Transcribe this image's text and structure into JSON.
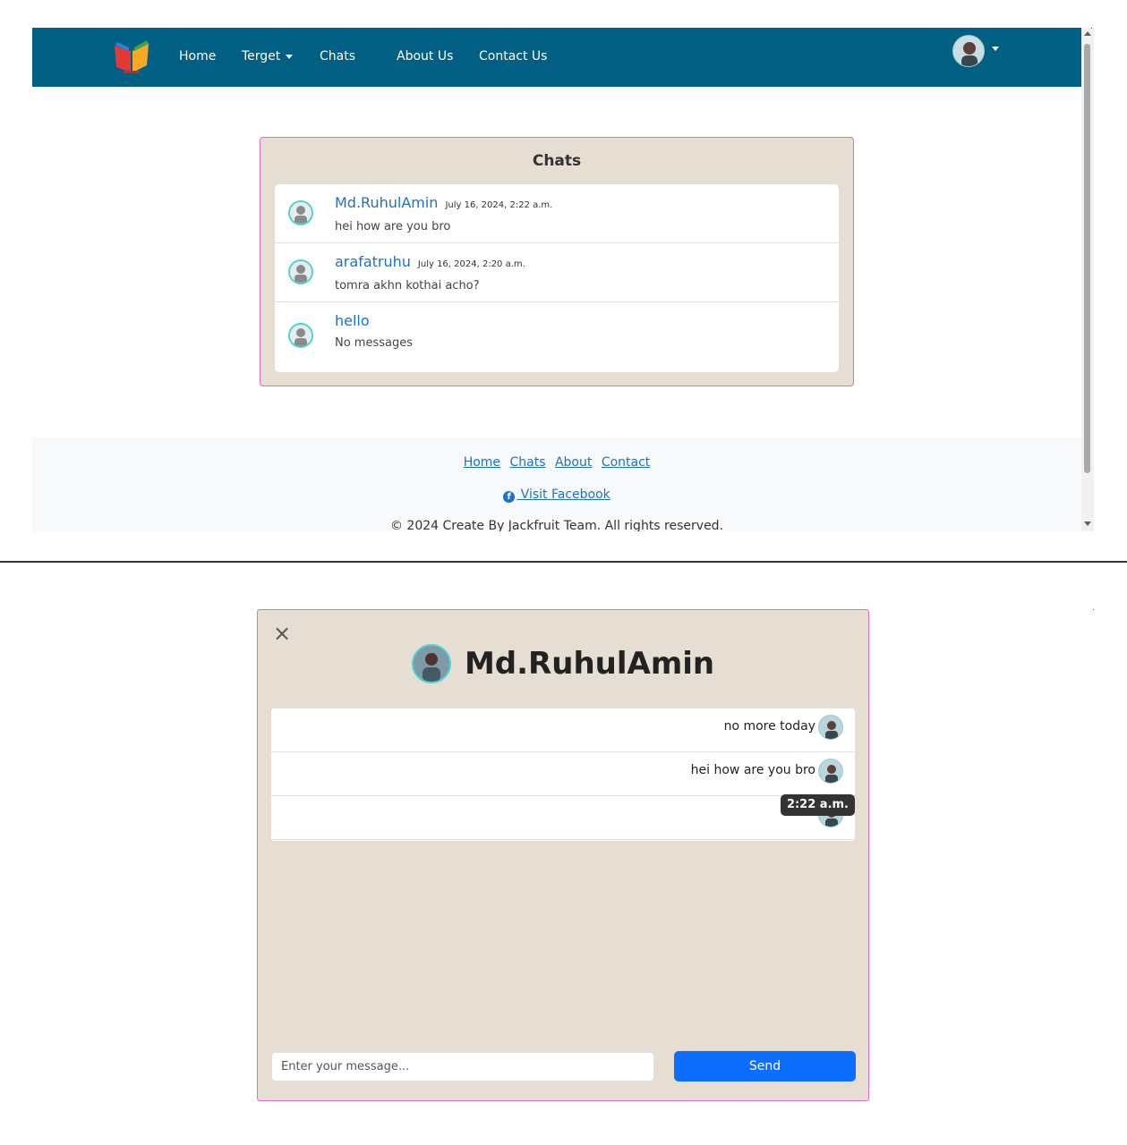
{
  "navbar": {
    "links": [
      "Home",
      "Terget",
      "Chats",
      "About Us",
      "Contact Us"
    ]
  },
  "chats_page": {
    "title": "Chats",
    "items": [
      {
        "name": "Md.RuhulAmin",
        "time": "July 16, 2024, 2:22 a.m.",
        "message": "hei how are you bro"
      },
      {
        "name": "arafatruhu",
        "time": "July 16, 2024, 2:20 a.m.",
        "message": "tomra akhn kothai acho?"
      },
      {
        "name": "hello",
        "time": "",
        "message": "No messages"
      }
    ]
  },
  "footer": {
    "links": [
      "Home",
      "Chats",
      "About",
      "Contact"
    ],
    "facebook_label": " Visit Facebook",
    "copyright": "© 2024 Create By Jackfruit Team. All rights reserved."
  },
  "chat_window": {
    "title": "Md.RuhulAmin",
    "messages": [
      "no more today",
      "hei how are you bro",
      ""
    ],
    "tooltip": "2:22 a.m.",
    "input_placeholder": "Enter your message...",
    "send_label": "Send"
  },
  "colors": {
    "navbar_bg": "#025f84",
    "card_bg": "#e6ddd3",
    "card_border": "#e46ac9",
    "link": "#1a73c9",
    "send_button": "#0d6efd"
  },
  "icons": [
    "brand-logo-icon",
    "user-avatar-icon",
    "caret-down-icon",
    "facebook-icon",
    "close-icon"
  ]
}
